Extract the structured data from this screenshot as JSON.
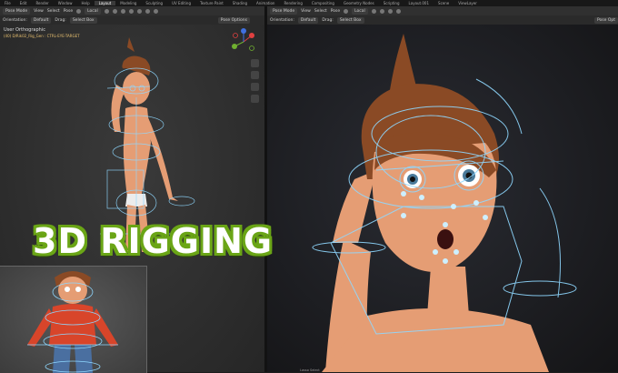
{
  "topbar": {
    "menus": [
      "File",
      "Edit",
      "Render",
      "Window",
      "Help"
    ],
    "workspaces": [
      "Layout",
      "Modeling",
      "Sculpting",
      "UV Editing",
      "Texture Paint",
      "Shading",
      "Animation",
      "Rendering",
      "Compositing",
      "Geometry Nodes",
      "Scripting",
      "Layout.001"
    ],
    "active_workspace": "Layout",
    "scene_label": "Scene",
    "view_layer_label": "ViewLayer"
  },
  "left_view": {
    "mode": "Pose Mode",
    "menu": [
      "View",
      "Select",
      "Pose"
    ],
    "transform": "Local",
    "orientation_label": "Orientation:",
    "orientation_value": "Default",
    "drag_label": "Drag:",
    "drag_value": "Select Box",
    "pose_options": "Pose Options",
    "viewport_title": "User Orthographic",
    "viewport_subtitle": "(40) D/Rik02_Rig_Gen : CTRL-EYE-TARGET"
  },
  "right_view": {
    "mode": "Pose Mode",
    "menu": [
      "View",
      "Select",
      "Pose"
    ],
    "transform": "Local",
    "orientation_label": "Orientation:",
    "orientation_value": "Default",
    "drag_label": "Drag:",
    "drag_value": "Select Box",
    "pose_options": "Pose Opt"
  },
  "banner": {
    "text": "3D RIGGING"
  },
  "status": {
    "text": "Lasso Select"
  },
  "colors": {
    "banner_outline": "#6aa516",
    "rig_lines": "#8fd8ff",
    "skin": "#e59d74",
    "hair": "#8a4a25",
    "jacket": "#d8452a"
  }
}
